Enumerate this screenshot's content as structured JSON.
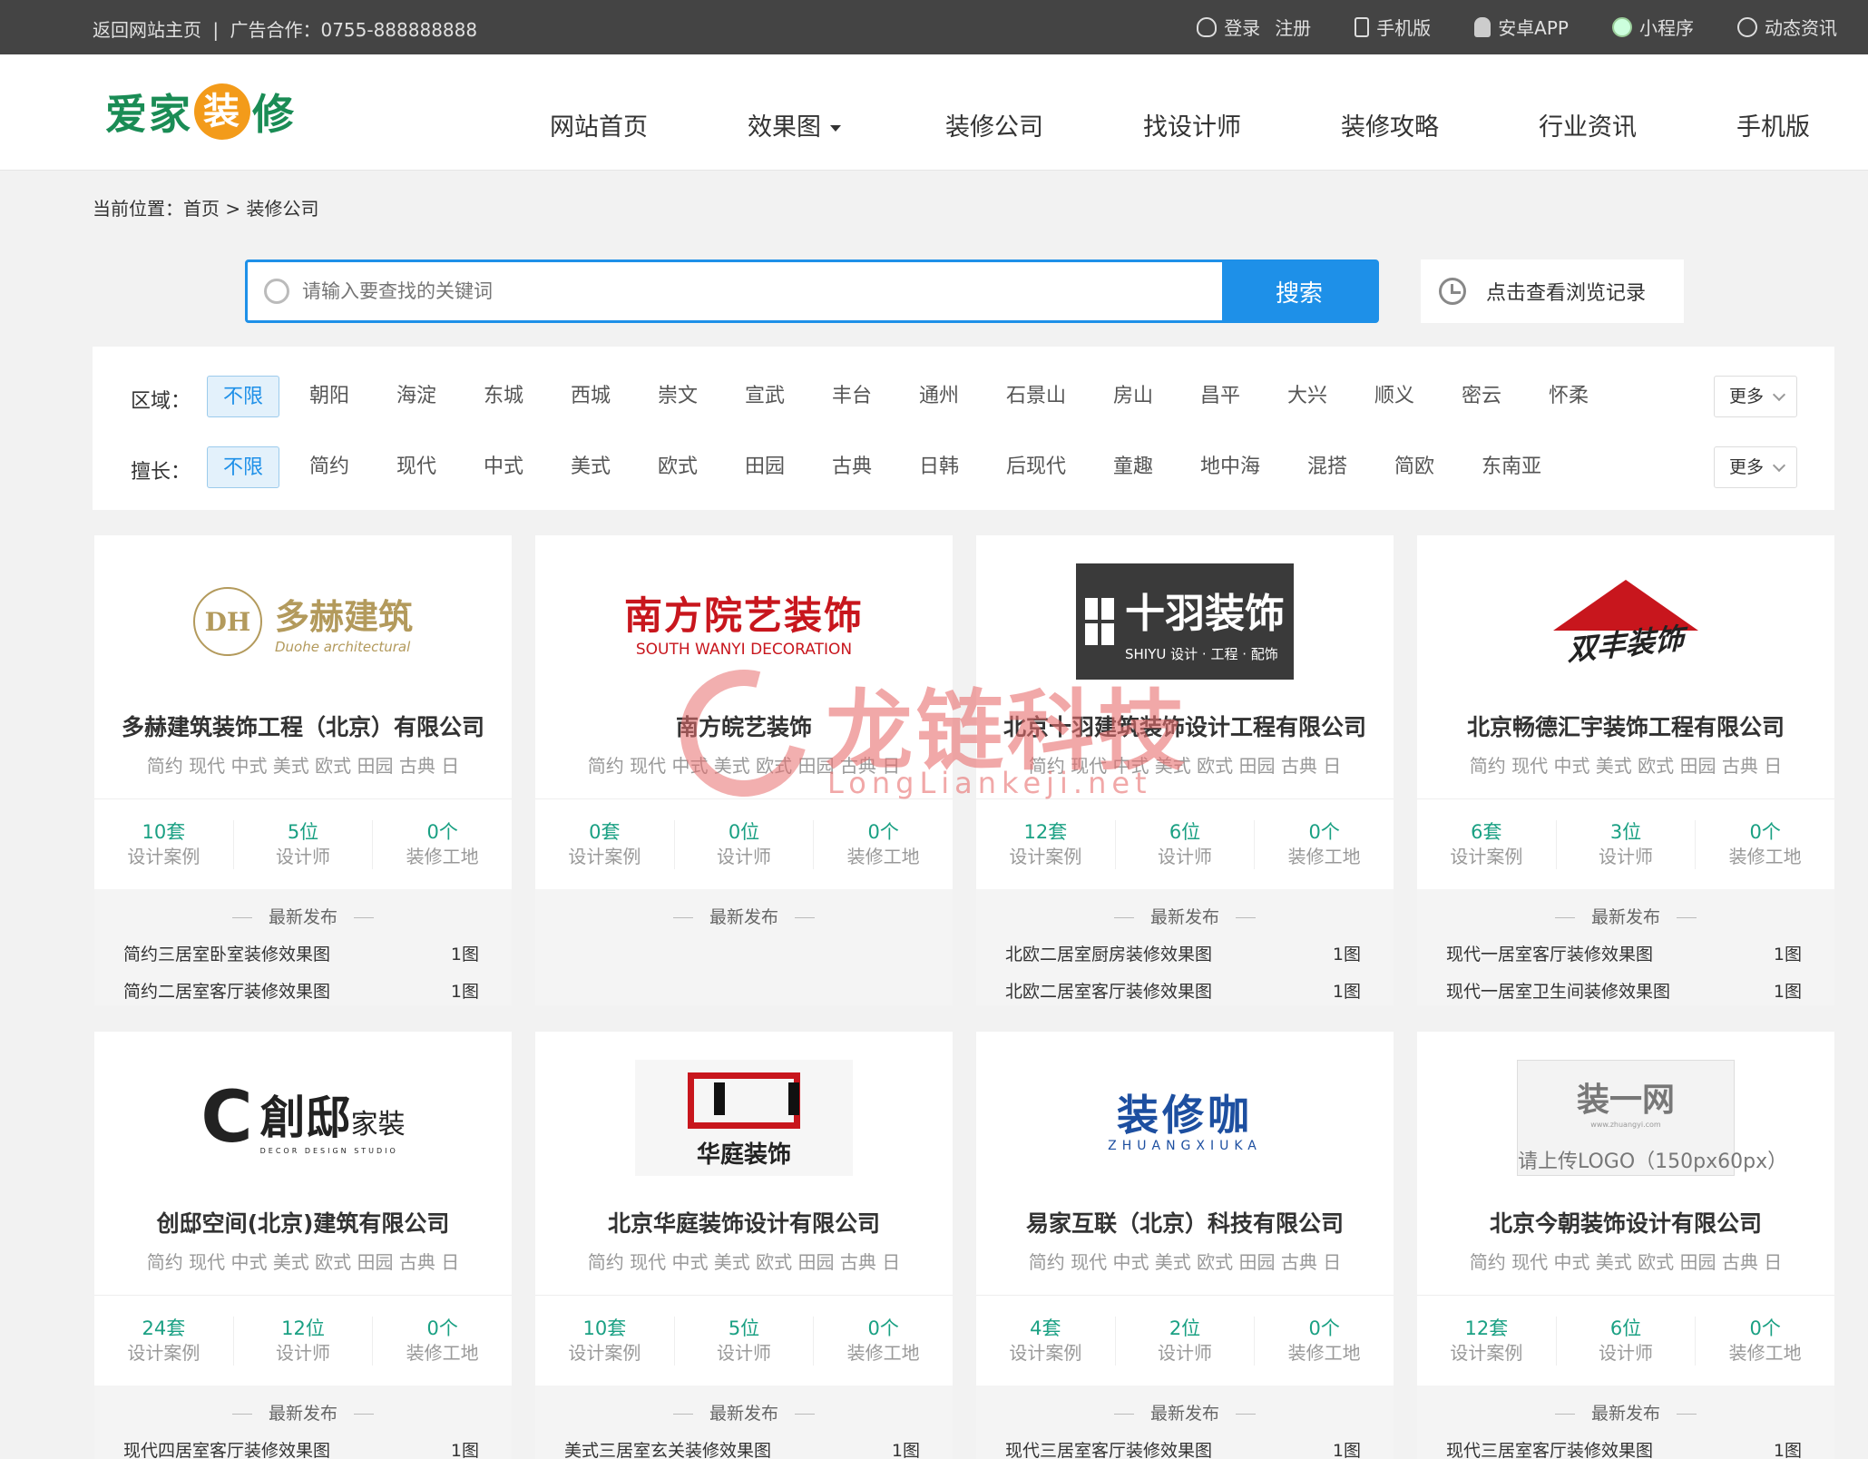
{
  "topbar": {
    "back_home": "返回网站主页",
    "separator": "|",
    "ad": "广告合作：0755-888888888",
    "login": "登录",
    "register": "注册",
    "mobile": "手机版",
    "android": "安卓APP",
    "miniprogram": "小程序",
    "news": "动态资讯"
  },
  "header": {
    "logo_part1": "爱家",
    "logo_part2": "装",
    "logo_part3": "修",
    "nav": [
      "网站首页",
      "效果图",
      "装修公司",
      "找设计师",
      "装修攻略",
      "行业资讯",
      "手机版"
    ]
  },
  "breadcrumb": {
    "prefix": "当前位置：",
    "home": "首页",
    "sep": ">",
    "current": "装修公司"
  },
  "search": {
    "placeholder": "请输入要查找的关键词",
    "button": "搜索",
    "history": "点击查看浏览记录"
  },
  "filters": {
    "region_label": "区域：",
    "region": [
      "不限",
      "朝阳",
      "海淀",
      "东城",
      "西城",
      "崇文",
      "宣武",
      "丰台",
      "通州",
      "石景山",
      "房山",
      "昌平",
      "大兴",
      "顺义",
      "密云",
      "怀柔"
    ],
    "specialty_label": "擅长：",
    "specialty": [
      "不限",
      "简约",
      "现代",
      "中式",
      "美式",
      "欧式",
      "田园",
      "古典",
      "日韩",
      "后现代",
      "童趣",
      "地中海",
      "混搭",
      "简欧",
      "东南亚"
    ],
    "more": "更多"
  },
  "tags": "简约 现代 中式 美式 欧式 田园 古典 日",
  "labels": {
    "cases": "设计案例",
    "designers": "设计师",
    "sites": "装修工地",
    "latest": "最新发布"
  },
  "companies": [
    {
      "name": "多赫建筑装饰工程（北京）有限公司",
      "logo": {
        "t1": "多赫建筑",
        "t2": "Duohe architectural",
        "mono": "DH"
      },
      "cases": "10套",
      "designers": "5位",
      "sites": "0个",
      "latest": [
        {
          "title": "简约三居室卧室装修效果图",
          "count": "1图"
        },
        {
          "title": "简约二居室客厅装修效果图",
          "count": "1图"
        }
      ]
    },
    {
      "name": "南方皖艺装饰",
      "logo": {
        "t1": "南方院艺装饰",
        "t2": "SOUTH WANYI DECORATION"
      },
      "cases": "0套",
      "designers": "0位",
      "sites": "0个",
      "latest": []
    },
    {
      "name": "北京十羽建筑装饰设计工程有限公司",
      "logo": {
        "t1": "十羽装饰",
        "t2": "SHIYU 设计 · 工程 · 配饰"
      },
      "cases": "12套",
      "designers": "6位",
      "sites": "0个",
      "latest": [
        {
          "title": "北欧二居室厨房装修效果图",
          "count": "1图"
        },
        {
          "title": "北欧二居室客厅装修效果图",
          "count": "1图"
        }
      ]
    },
    {
      "name": "北京畅德汇宇装饰工程有限公司",
      "logo": {
        "t1": "双丰装饰"
      },
      "cases": "6套",
      "designers": "3位",
      "sites": "0个",
      "latest": [
        {
          "title": "现代一居室客厅装修效果图",
          "count": "1图"
        },
        {
          "title": "现代一居室卫生间装修效果图",
          "count": "1图"
        }
      ]
    },
    {
      "name": "创邸空间(北京)建筑有限公司",
      "logo": {
        "c": "C",
        "t1": "創邸",
        "t2": "家裝",
        "t3": "DECOR DESIGN STUDIO"
      },
      "cases": "24套",
      "designers": "12位",
      "sites": "0个",
      "latest": [
        {
          "title": "现代四居室客厅装修效果图",
          "count": "1图"
        }
      ]
    },
    {
      "name": "北京华庭装饰设计有限公司",
      "logo": {
        "t1": "华庭装饰"
      },
      "cases": "10套",
      "designers": "5位",
      "sites": "0个",
      "latest": [
        {
          "title": "美式三居室玄关装修效果图",
          "count": "1图"
        }
      ]
    },
    {
      "name": "易家互联（北京）科技有限公司",
      "logo": {
        "t1": "装修咖",
        "t2": "ZHUANGXIUKA"
      },
      "cases": "4套",
      "designers": "2位",
      "sites": "0个",
      "latest": [
        {
          "title": "现代三居室客厅装修效果图",
          "count": "1图"
        }
      ]
    },
    {
      "name": "北京今朝装饰设计有限公司",
      "logo": {
        "t1": "装一网",
        "t2": "www.zhuangyi.com",
        "t3": "请上传LOGO（150px60px）"
      },
      "cases": "12套",
      "designers": "6位",
      "sites": "0个",
      "latest": [
        {
          "title": "现代三居室客厅装修效果图",
          "count": "1图"
        }
      ]
    }
  ],
  "watermark": {
    "t1": "龙链科技",
    "t2": "LongLiankeji.net"
  }
}
